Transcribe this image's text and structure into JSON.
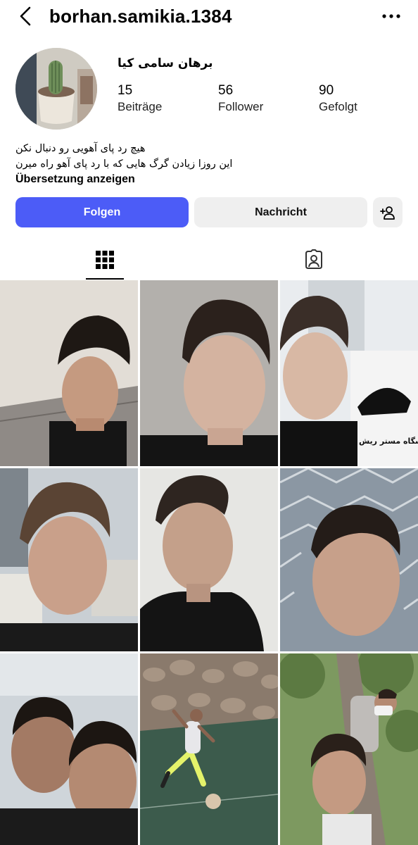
{
  "header": {
    "username": "borhan.samikia.1384"
  },
  "profile": {
    "display_name": "برهان سامی کیا",
    "stats": [
      {
        "value": "15",
        "label": "Beiträge"
      },
      {
        "value": "56",
        "label": "Follower"
      },
      {
        "value": "90",
        "label": "Gefolgt"
      }
    ],
    "bio_lines": [
      "هیچ رد پای آهویی رو دنبال نکن",
      "این روزا زیادن گرگ هایی که با رد پای آهو راه میرن"
    ],
    "translate_link": "Übersetzung anzeigen"
  },
  "actions": {
    "follow_label": "Folgen",
    "message_label": "Nachricht"
  },
  "colors": {
    "accent": "#4c5cf7",
    "button_grey": "#efefef"
  },
  "tabs": [
    {
      "icon": "grid-icon",
      "active": true
    },
    {
      "icon": "tagged-person-icon",
      "active": false
    }
  ],
  "posts": [
    {
      "id": 1,
      "kind": "selfie-indoor"
    },
    {
      "id": 2,
      "kind": "selfie-stone-wall"
    },
    {
      "id": 3,
      "kind": "selfie-shop-sign",
      "sign_text": "پیرایشگاه مستر ریش"
    },
    {
      "id": 4,
      "kind": "selfie-street-car"
    },
    {
      "id": 5,
      "kind": "selfie-white-wall"
    },
    {
      "id": 6,
      "kind": "selfie-fence"
    },
    {
      "id": 7,
      "kind": "two-boys-selfie"
    },
    {
      "id": 8,
      "kind": "football-field"
    },
    {
      "id": 9,
      "kind": "boys-in-tree"
    }
  ]
}
